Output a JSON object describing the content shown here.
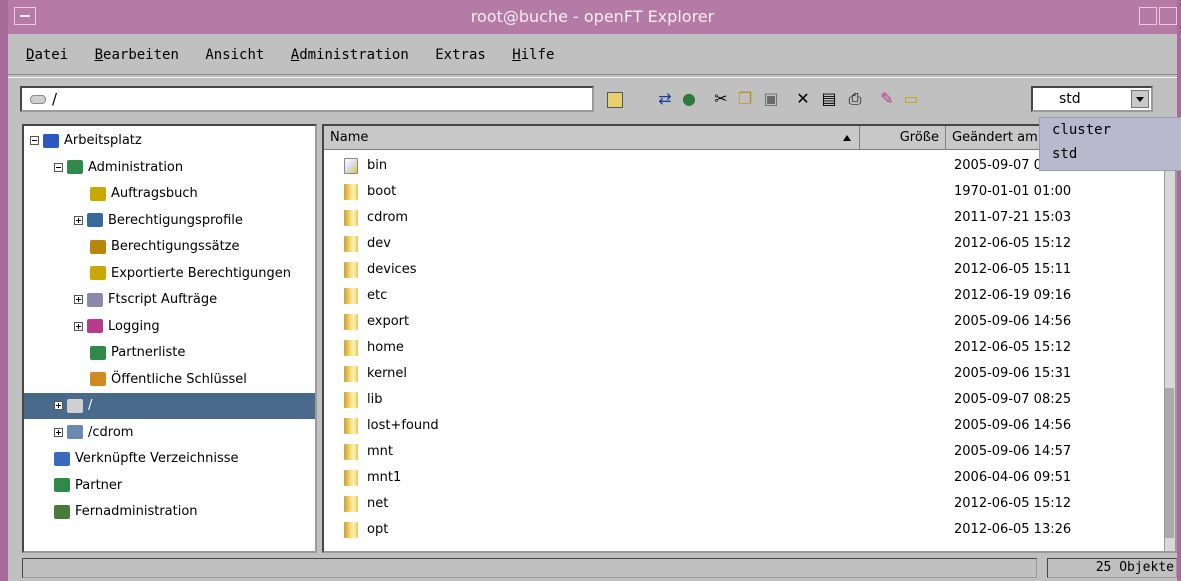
{
  "window": {
    "title": "root@buche - openFT Explorer"
  },
  "menu": [
    "Datei",
    "Bearbeiten",
    "Ansicht",
    "Administration",
    "Extras",
    "Hilfe"
  ],
  "toolbar": {
    "path_value": "/",
    "selector_value": "std",
    "selector_options": [
      "cluster",
      "std"
    ]
  },
  "tree": [
    {
      "label": "Arbeitsplatz",
      "icon": "computer-icon",
      "color": "#2a58c0"
    },
    {
      "label": "Administration",
      "icon": "admin-icon",
      "color": "#2f8a4a"
    },
    {
      "label": "Auftragsbuch",
      "icon": "request-queue-icon",
      "color": "#c8a800"
    },
    {
      "label": "Berechtigungsprofile",
      "icon": "profile-icon",
      "color": "#3a6a9a"
    },
    {
      "label": "Berechtigungssätze",
      "icon": "lock-icon",
      "color": "#b8860b"
    },
    {
      "label": "Exportierte Berechtigungen",
      "icon": "export-icon",
      "color": "#c8a800"
    },
    {
      "label": "Ftscript Aufträge",
      "icon": "script-icon",
      "color": "#8a8aa8"
    },
    {
      "label": "Logging",
      "icon": "logging-icon",
      "color": "#b83a8a"
    },
    {
      "label": "Partnerliste",
      "icon": "partner-list-icon",
      "color": "#2f8a4a"
    },
    {
      "label": "Öffentliche Schlüssel",
      "icon": "key-icon",
      "color": "#d08a20"
    },
    {
      "label": "/",
      "icon": "drive-icon",
      "color": "#d0d0d0"
    },
    {
      "label": "/cdrom",
      "icon": "cdrom-icon",
      "color": "#6a8ab0"
    },
    {
      "label": "Verknüpfte Verzeichnisse",
      "icon": "linked-dirs-icon",
      "color": "#3a6ac0"
    },
    {
      "label": "Partner",
      "icon": "partner-icon",
      "color": "#2f8a4a"
    },
    {
      "label": "Fernadministration",
      "icon": "remote-admin-icon",
      "color": "#4a7a3a"
    }
  ],
  "columns": {
    "name": "Name",
    "size": "Größe",
    "modified": "Geändert am"
  },
  "files": [
    {
      "name": "bin",
      "modified": "2005-09-07 08:25",
      "link": true
    },
    {
      "name": "boot",
      "modified": "1970-01-01 01:00"
    },
    {
      "name": "cdrom",
      "modified": "2011-07-21 15:03"
    },
    {
      "name": "dev",
      "modified": "2012-06-05 15:12"
    },
    {
      "name": "devices",
      "modified": "2012-06-05 15:11"
    },
    {
      "name": "etc",
      "modified": "2012-06-19 09:16"
    },
    {
      "name": "export",
      "modified": "2005-09-06 14:56"
    },
    {
      "name": "home",
      "modified": "2012-06-05 15:12"
    },
    {
      "name": "kernel",
      "modified": "2005-09-06 15:31"
    },
    {
      "name": "lib",
      "modified": "2005-09-07 08:25"
    },
    {
      "name": "lost+found",
      "modified": "2005-09-06 14:56"
    },
    {
      "name": "mnt",
      "modified": "2005-09-06 14:57"
    },
    {
      "name": "mnt1",
      "modified": "2006-04-06 09:51"
    },
    {
      "name": "net",
      "modified": "2012-06-05 15:12"
    },
    {
      "name": "opt",
      "modified": "2012-06-05 13:26"
    }
  ],
  "status": {
    "count": "25 Objekte"
  }
}
